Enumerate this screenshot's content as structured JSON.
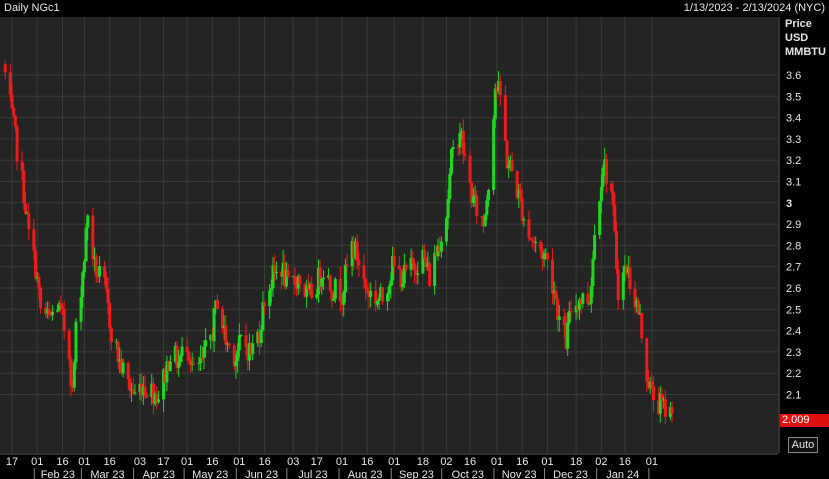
{
  "title": "Daily NGc1",
  "range_label": "1/13/2023 - 2/13/2024 (NYC)",
  "unit": [
    "Price",
    "USD",
    "MMBTU"
  ],
  "last_price": "2.009",
  "auto_button": "Auto",
  "colors": {
    "up": "#1ed81e",
    "down": "#ee1b1b",
    "grid": "#3a3a3a",
    "last_price_bg": "#e01010"
  },
  "chart_data": {
    "type": "candlestick",
    "y_axis": {
      "ticks": [
        "3.6",
        "3.5",
        "3.4",
        "3.3",
        "3.2",
        "3.1",
        "3",
        "2.9",
        "2.8",
        "2.7",
        "2.6",
        "2.5",
        "2.4",
        "2.3",
        "2.2",
        "2.1"
      ],
      "range": [
        1.95,
        3.75
      ],
      "bold_tick": "3"
    },
    "x_axis": {
      "ticks": [
        {
          "label": "17",
          "date": "2023-01-17"
        },
        {
          "label": "01",
          "date": "2023-02-01"
        },
        {
          "label": "16",
          "date": "2023-02-16"
        },
        {
          "label": "01",
          "date": "2023-03-01"
        },
        {
          "label": "16",
          "date": "2023-03-16"
        },
        {
          "label": "03",
          "date": "2023-04-03"
        },
        {
          "label": "17",
          "date": "2023-04-17"
        },
        {
          "label": "01",
          "date": "2023-05-01"
        },
        {
          "label": "16",
          "date": "2023-05-16"
        },
        {
          "label": "01",
          "date": "2023-06-01"
        },
        {
          "label": "16",
          "date": "2023-06-16"
        },
        {
          "label": "03",
          "date": "2023-07-03"
        },
        {
          "label": "17",
          "date": "2023-07-17"
        },
        {
          "label": "01",
          "date": "2023-08-01"
        },
        {
          "label": "16",
          "date": "2023-08-16"
        },
        {
          "label": "01",
          "date": "2023-09-01"
        },
        {
          "label": "18",
          "date": "2023-09-18"
        },
        {
          "label": "02",
          "date": "2023-10-02"
        },
        {
          "label": "16",
          "date": "2023-10-16"
        },
        {
          "label": "01",
          "date": "2023-11-01"
        },
        {
          "label": "16",
          "date": "2023-11-16"
        },
        {
          "label": "01",
          "date": "2023-12-01"
        },
        {
          "label": "18",
          "date": "2023-12-18"
        },
        {
          "label": "02",
          "date": "2024-01-02"
        },
        {
          "label": "16",
          "date": "2024-01-16"
        },
        {
          "label": "01",
          "date": "2024-02-01"
        }
      ],
      "months": [
        "Feb 23",
        "Mar 23",
        "Apr 23",
        "May 23",
        "Jun 23",
        "Jul 23",
        "Aug 23",
        "Sep 23",
        "Oct 23",
        "Nov 23",
        "Dec 23",
        "Jan 24"
      ]
    },
    "close_path": [
      [
        "2023-01-13",
        3.6
      ],
      [
        "2023-01-18",
        3.35
      ],
      [
        "2023-01-24",
        3.05
      ],
      [
        "2023-01-27",
        2.85
      ],
      [
        "2023-01-31",
        2.7
      ],
      [
        "2023-02-03",
        2.5
      ],
      [
        "2023-02-08",
        2.45
      ],
      [
        "2023-02-13",
        2.52
      ],
      [
        "2023-02-16",
        2.45
      ],
      [
        "2023-02-20",
        2.3
      ],
      [
        "2023-02-22",
        2.1
      ],
      [
        "2023-02-24",
        2.4
      ],
      [
        "2023-03-01",
        2.75
      ],
      [
        "2023-03-03",
        2.95
      ],
      [
        "2023-03-07",
        2.7
      ],
      [
        "2023-03-13",
        2.6
      ],
      [
        "2023-03-17",
        2.4
      ],
      [
        "2023-03-22",
        2.25
      ],
      [
        "2023-03-27",
        2.15
      ],
      [
        "2023-03-31",
        2.1
      ],
      [
        "2023-04-04",
        2.15
      ],
      [
        "2023-04-10",
        2.12
      ],
      [
        "2023-04-14",
        2.1
      ],
      [
        "2023-04-18",
        2.2
      ],
      [
        "2023-04-21",
        2.3
      ],
      [
        "2023-04-26",
        2.25
      ],
      [
        "2023-05-01",
        2.35
      ],
      [
        "2023-05-05",
        2.2
      ],
      [
        "2023-05-10",
        2.25
      ],
      [
        "2023-05-16",
        2.4
      ],
      [
        "2023-05-19",
        2.55
      ],
      [
        "2023-05-24",
        2.35
      ],
      [
        "2023-05-30",
        2.28
      ],
      [
        "2023-06-02",
        2.35
      ],
      [
        "2023-06-08",
        2.3
      ],
      [
        "2023-06-13",
        2.4
      ],
      [
        "2023-06-16",
        2.55
      ],
      [
        "2023-06-21",
        2.65
      ],
      [
        "2023-06-26",
        2.7
      ],
      [
        "2023-06-30",
        2.6
      ],
      [
        "2023-07-06",
        2.65
      ],
      [
        "2023-07-12",
        2.55
      ],
      [
        "2023-07-17",
        2.62
      ],
      [
        "2023-07-21",
        2.7
      ],
      [
        "2023-07-26",
        2.6
      ],
      [
        "2023-08-01",
        2.58
      ],
      [
        "2023-08-07",
        2.8
      ],
      [
        "2023-08-10",
        2.75
      ],
      [
        "2023-08-15",
        2.6
      ],
      [
        "2023-08-21",
        2.55
      ],
      [
        "2023-08-25",
        2.55
      ],
      [
        "2023-08-31",
        2.7
      ],
      [
        "2023-09-06",
        2.65
      ],
      [
        "2023-09-12",
        2.7
      ],
      [
        "2023-09-18",
        2.75
      ],
      [
        "2023-09-22",
        2.65
      ],
      [
        "2023-09-27",
        2.8
      ],
      [
        "2023-10-02",
        2.95
      ],
      [
        "2023-10-05",
        3.2
      ],
      [
        "2023-10-10",
        3.35
      ],
      [
        "2023-10-13",
        3.2
      ],
      [
        "2023-10-18",
        3.0
      ],
      [
        "2023-10-24",
        2.9
      ],
      [
        "2023-10-27",
        3.1
      ],
      [
        "2023-10-31",
        3.55
      ],
      [
        "2023-11-03",
        3.5
      ],
      [
        "2023-11-07",
        3.2
      ],
      [
        "2023-11-10",
        3.15
      ],
      [
        "2023-11-15",
        3.0
      ],
      [
        "2023-11-20",
        2.85
      ],
      [
        "2023-11-24",
        2.8
      ],
      [
        "2023-11-30",
        2.75
      ],
      [
        "2023-12-05",
        2.6
      ],
      [
        "2023-12-08",
        2.45
      ],
      [
        "2023-12-12",
        2.35
      ],
      [
        "2023-12-15",
        2.5
      ],
      [
        "2023-12-20",
        2.55
      ],
      [
        "2023-12-26",
        2.55
      ],
      [
        "2023-12-29",
        2.85
      ],
      [
        "2024-01-03",
        3.2
      ],
      [
        "2024-01-08",
        3.05
      ],
      [
        "2024-01-12",
        2.6
      ],
      [
        "2024-01-17",
        2.7
      ],
      [
        "2024-01-22",
        2.55
      ],
      [
        "2024-01-25",
        2.45
      ],
      [
        "2024-01-29",
        2.2
      ],
      [
        "2024-02-01",
        2.1
      ],
      [
        "2024-02-06",
        2.05
      ],
      [
        "2024-02-13",
        2.009
      ]
    ]
  }
}
